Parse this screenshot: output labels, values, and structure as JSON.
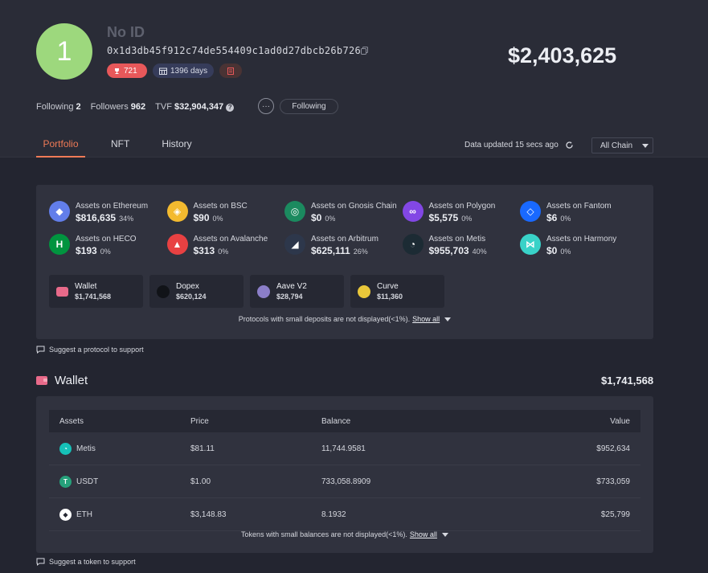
{
  "profile": {
    "avatar_text": "1",
    "name": "No ID",
    "address": "0x1d3db45f912c74de554409c1ad0d27dbcb26b726",
    "rank": "721",
    "days": "1396 days",
    "total_value": "$2,403,625"
  },
  "stats": {
    "following_label": "Following",
    "following_count": "2",
    "followers_label": "Followers",
    "followers_count": "962",
    "tvf_label": "TVF",
    "tvf_value": "$32,904,347",
    "follow_button": "Following"
  },
  "tabs": [
    {
      "label": "Portfolio",
      "active": true
    },
    {
      "label": "NFT",
      "active": false
    },
    {
      "label": "History",
      "active": false
    }
  ],
  "data_updated": "Data updated 15 secs ago",
  "chain_filter": "All Chain",
  "chains": [
    {
      "name": "Assets on Ethereum",
      "value": "$816,635",
      "pct": "34%",
      "color": "#627eea",
      "icon": "ethereum-icon"
    },
    {
      "name": "Assets on BSC",
      "value": "$90",
      "pct": "0%",
      "color": "#f3ba2f",
      "icon": "bsc-icon"
    },
    {
      "name": "Assets on Gnosis Chain",
      "value": "$0",
      "pct": "0%",
      "color": "#1b8a5f",
      "icon": "gnosis-icon"
    },
    {
      "name": "Assets on Polygon",
      "value": "$5,575",
      "pct": "0%",
      "color": "#8247e5",
      "icon": "polygon-icon"
    },
    {
      "name": "Assets on Fantom",
      "value": "$6",
      "pct": "0%",
      "color": "#1969ff",
      "icon": "fantom-icon"
    },
    {
      "name": "Assets on HECO",
      "value": "$193",
      "pct": "0%",
      "color": "#01943f",
      "icon": "heco-icon"
    },
    {
      "name": "Assets on Avalanche",
      "value": "$313",
      "pct": "0%",
      "color": "#e84142",
      "icon": "avalanche-icon"
    },
    {
      "name": "Assets on Arbitrum",
      "value": "$625,111",
      "pct": "26%",
      "color": "#2d374b",
      "icon": "arbitrum-icon"
    },
    {
      "name": "Assets on Metis",
      "value": "$955,703",
      "pct": "40%",
      "color": "#1c2b34",
      "icon": "metis-icon"
    },
    {
      "name": "Assets on Harmony",
      "value": "$0",
      "pct": "0%",
      "color": "#39d2c8",
      "icon": "harmony-icon"
    }
  ],
  "protocols": [
    {
      "name": "Wallet",
      "value": "$1,741,568",
      "color": "#e86a8a",
      "icon": "wallet-icon"
    },
    {
      "name": "Dopex",
      "value": "$620,124",
      "color": "#111318",
      "icon": "dopex-icon"
    },
    {
      "name": "Aave V2",
      "value": "$28,794",
      "color": "#8b7ec8",
      "icon": "aave-icon"
    },
    {
      "name": "Curve",
      "value": "$11,360",
      "color": "#e9c73a",
      "icon": "curve-icon"
    }
  ],
  "protocol_note": "Protocols with small deposits are not displayed(<1%).",
  "show_all": "Show all",
  "suggest_protocol": "Suggest a protocol to support",
  "wallet": {
    "title": "Wallet",
    "total": "$1,741,568",
    "headers": {
      "assets": "Assets",
      "price": "Price",
      "balance": "Balance",
      "value": "Value"
    },
    "rows": [
      {
        "asset": "Metis",
        "price": "$81.11",
        "balance": "11,744.9581",
        "value": "$952,634",
        "color": "#16c1b8",
        "icon": "metis-token-icon"
      },
      {
        "asset": "USDT",
        "price": "$1.00",
        "balance": "733,058.8909",
        "value": "$733,059",
        "color": "#26a17b",
        "icon": "usdt-icon"
      },
      {
        "asset": "ETH",
        "price": "$3,148.83",
        "balance": "8.1932",
        "value": "$25,799",
        "color": "#ffffff",
        "icon": "eth-icon"
      }
    ],
    "token_note": "Tokens with small balances are not displayed(<1%).",
    "show_all": "Show all"
  },
  "suggest_token": "Suggest a token to support"
}
